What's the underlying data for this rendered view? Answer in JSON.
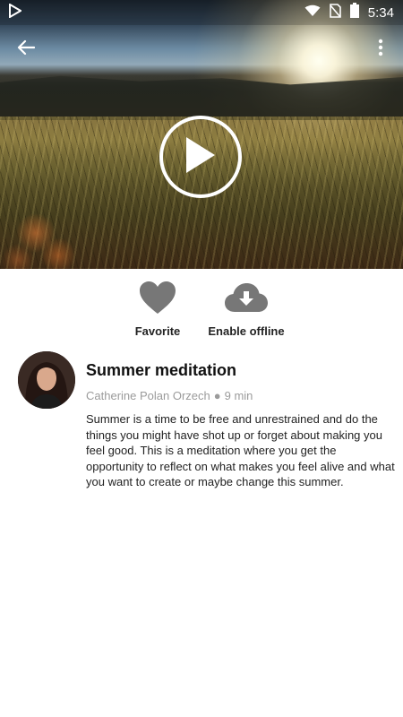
{
  "status_bar": {
    "time": "5:34",
    "icons": [
      "play-store-icon",
      "wifi-icon",
      "no-sim-icon",
      "battery-icon"
    ]
  },
  "header": {
    "back_icon": "back-arrow-icon",
    "more_icon": "more-vert-icon"
  },
  "player": {
    "play_icon": "play-icon"
  },
  "actions": {
    "favorite_label": "Favorite",
    "offline_label": "Enable offline",
    "icon_color": "#777777"
  },
  "meditation": {
    "title": "Summer meditation",
    "author": "Catherine Polan Orzech",
    "separator": "●",
    "duration": "9 min",
    "description": "Summer is a time to be free and unrestrained and do the things you might have shot up or forget about making you feel good. This is a meditation where you get the opportunity to reflect on what makes you feel alive and what you want to create or maybe change this summer."
  }
}
